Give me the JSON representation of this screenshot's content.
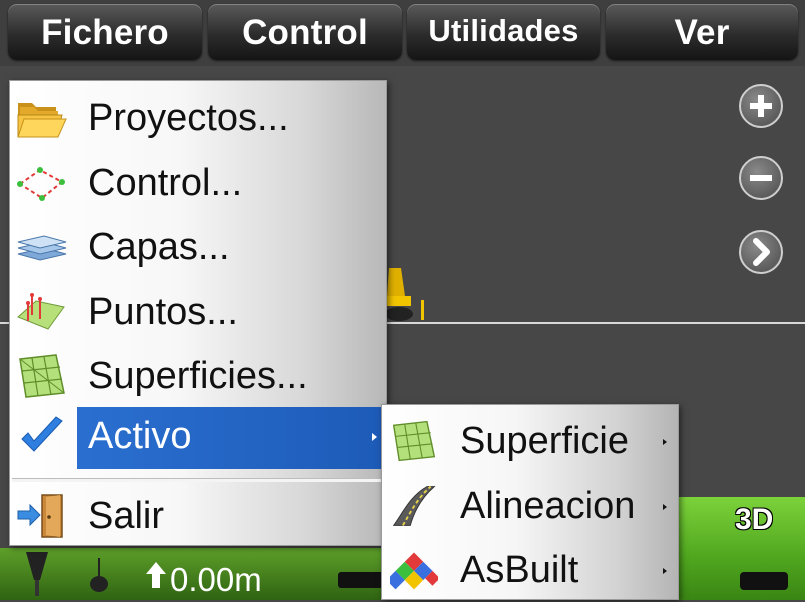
{
  "menubar": {
    "fichero": "Fichero",
    "control": "Control",
    "utilidades": "Utilidades",
    "ver": "Ver"
  },
  "fichero_menu": {
    "items": [
      {
        "label": "Proyectos...",
        "icon": "folder-icon"
      },
      {
        "label": "Control...",
        "icon": "control-points-icon"
      },
      {
        "label": "Capas...",
        "icon": "layers-icon"
      },
      {
        "label": "Puntos...",
        "icon": "points-surface-icon"
      },
      {
        "label": "Superficies...",
        "icon": "surface-mesh-icon"
      },
      {
        "label": "Activo",
        "icon": "checkmark-icon",
        "has_submenu": true,
        "highlighted": true
      },
      {
        "label": "Salir",
        "icon": "exit-door-icon"
      }
    ]
  },
  "activo_submenu": {
    "items": [
      {
        "label": "Superficie",
        "icon": "surface-mesh-icon",
        "has_submenu": true
      },
      {
        "label": "Alineacion",
        "icon": "road-alignment-icon",
        "has_submenu": true
      },
      {
        "label": "AsBuilt",
        "icon": "asbuilt-grid-icon",
        "has_submenu": true
      }
    ]
  },
  "map_controls": {
    "zoom_in": "plus-icon",
    "zoom_out": "minus-icon",
    "next": "chevron-right-icon"
  },
  "status": {
    "height_value": "0.00m",
    "view_mode": "3D"
  },
  "colors": {
    "menu_highlight": "#1e5bb8",
    "status_green": "#4fa61e",
    "background": "#474747"
  }
}
